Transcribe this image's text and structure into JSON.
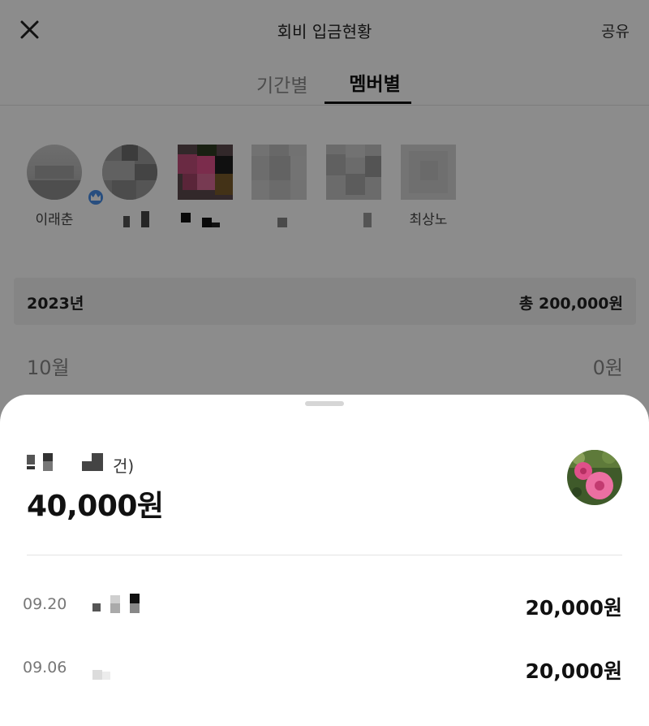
{
  "header": {
    "title": "회비 입금현황",
    "share_label": "공유",
    "close_icon": "close-icon"
  },
  "tabs": [
    {
      "label": "기간별",
      "active": false
    },
    {
      "label": "멤버별",
      "active": true
    }
  ],
  "members": [
    {
      "name": "이래춘",
      "is_leader": true
    },
    {
      "name": ""
    },
    {
      "name": ""
    },
    {
      "name": ""
    },
    {
      "name": ""
    },
    {
      "name": "최상노"
    }
  ],
  "summary": {
    "year_label": "2023년",
    "year_total": "총 200,000원",
    "month_label": "10월",
    "month_amount": "0원"
  },
  "sheet": {
    "subtitle": "건)",
    "total": "40,000원",
    "transactions": [
      {
        "date": "09.20",
        "amount": "20,000원"
      },
      {
        "date": "09.06",
        "amount": "20,000원"
      }
    ]
  },
  "colors": {
    "dim_overlay": "#000000",
    "accent_blue": "#4a8fe8",
    "flower_pink": "#e0508a"
  }
}
